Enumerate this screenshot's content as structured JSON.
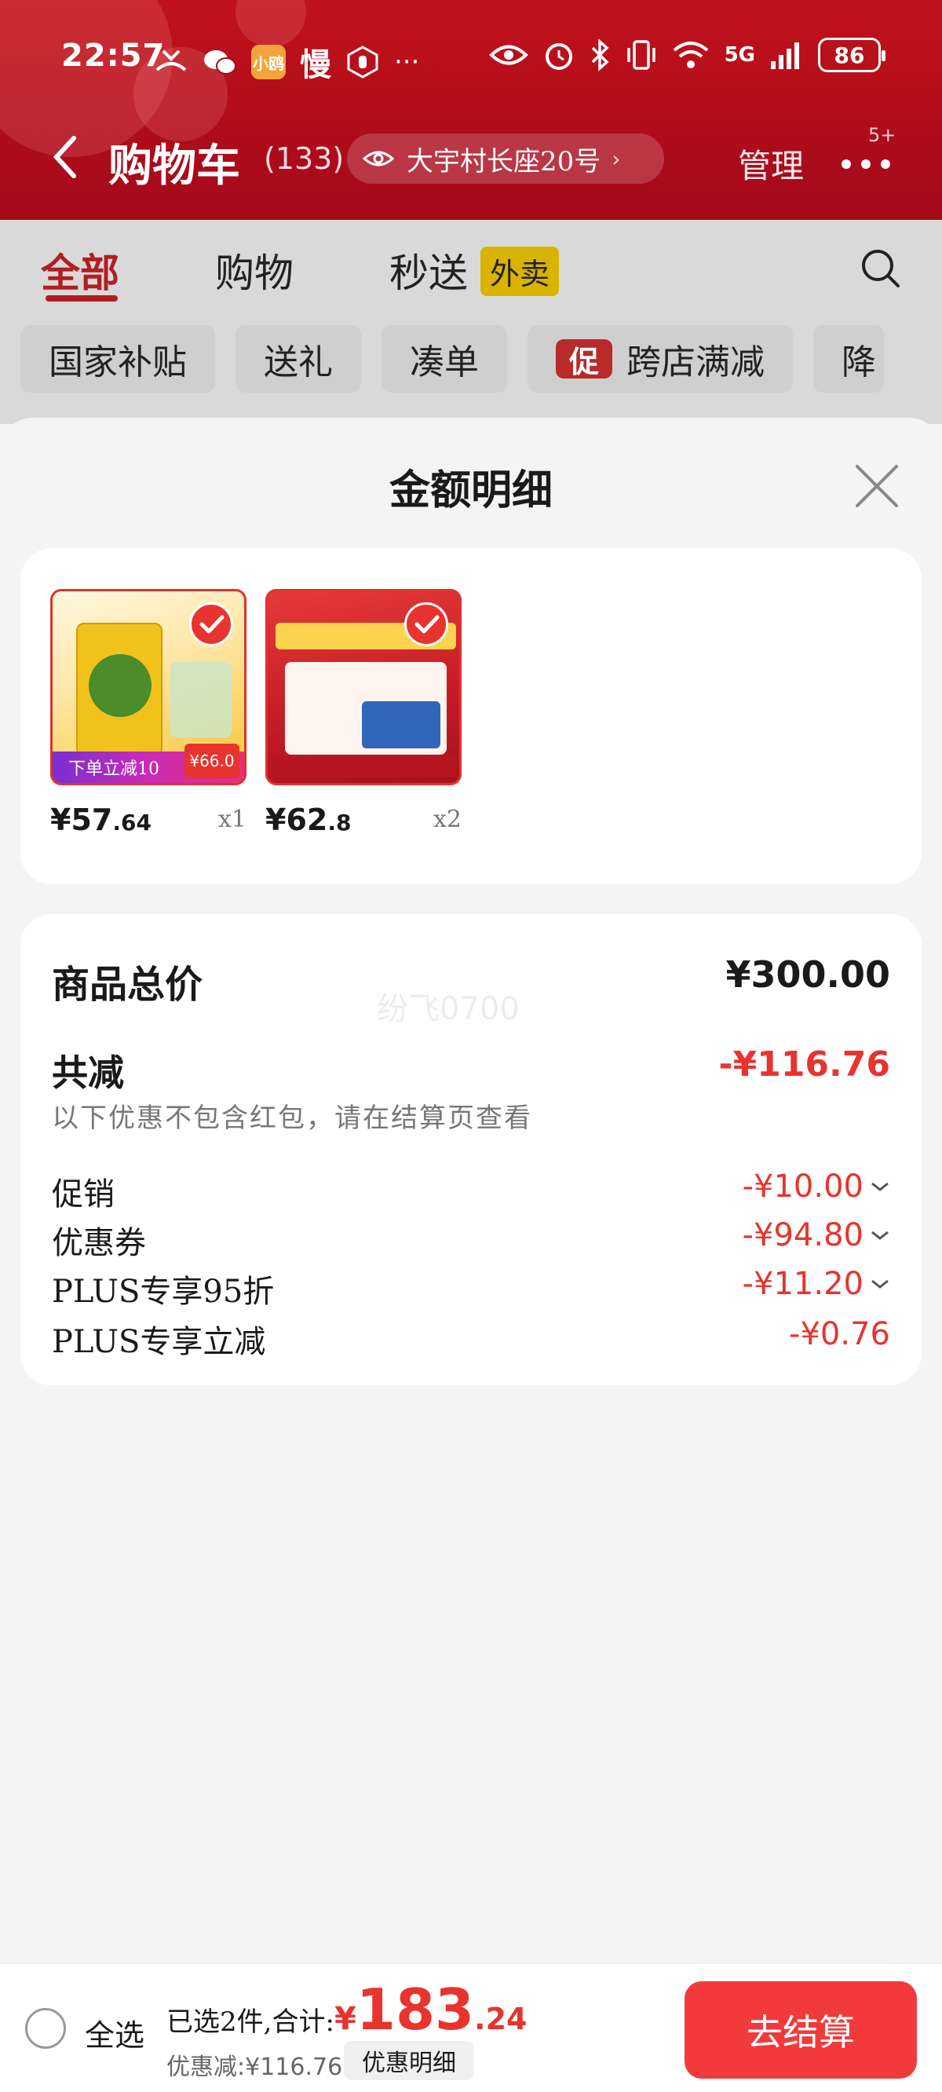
{
  "status_bar": {
    "time": "22:57",
    "left_icons": [
      "missed-call-icon",
      "wechat-icon",
      "xiaohongshu-icon",
      "slow-icon",
      "hand-icon",
      "more-icon"
    ],
    "app_badge": "小鸥",
    "slow_label": "慢",
    "overflow": "···",
    "right_icons": [
      "eye-icon",
      "alarm-icon",
      "bluetooth-icon",
      "vibrate-icon",
      "wifi-icon",
      "signal-icon"
    ],
    "network": "5G",
    "battery": "86"
  },
  "nav": {
    "title": "购物车",
    "count": "(133)",
    "address": "大宇村长座20号",
    "manage": "管理",
    "badge": "5+"
  },
  "tabs": [
    {
      "label": "全部"
    },
    {
      "label": "购物"
    },
    {
      "label": "秒送"
    }
  ],
  "tab_waimai": "外卖",
  "filters": [
    "国家补贴",
    "送礼",
    "凑单",
    "跨店满减",
    "降"
  ],
  "filter_promo_tag": "促",
  "sheet": {
    "title": "金额明细",
    "products": [
      {
        "price_int": "¥57",
        "price_dec": ".64",
        "qty": "x1",
        "bar_text": "下单立减10",
        "tag_text": "¥66.0"
      },
      {
        "price_int": "¥62",
        "price_dec": ".8",
        "qty": "x2"
      }
    ],
    "summary": {
      "total_label": "商品总价",
      "total_value": "¥300.00",
      "watermark": "纷飞0700",
      "reduce_label": "共减",
      "reduce_value": "-¥116.76",
      "reduce_note": "以下优惠不包含红包，请在结算页查看",
      "details": [
        {
          "label": "促销",
          "value": "-¥10.00",
          "expandable": true
        },
        {
          "label": "优惠券",
          "value": "-¥94.80",
          "expandable": true
        },
        {
          "label": "PLUS专享95折",
          "value": "-¥11.20",
          "expandable": true
        },
        {
          "label": "PLUS专享立减",
          "value": "-¥0.76",
          "expandable": false
        }
      ]
    }
  },
  "bottom_bar": {
    "select_all": "全选",
    "selected_text": "已选2件,合计:",
    "price_yen": "¥",
    "price_int": "183",
    "price_dec": ".24",
    "discount_text": "优惠减:¥116.76",
    "discount_button": "优惠明细",
    "checkout": "去结算"
  },
  "colors": {
    "brand_red": "#c1121c",
    "accent_red": "#e8332e",
    "checkout_red": "#f23a3c",
    "waimai_yellow": "#d8b400"
  }
}
